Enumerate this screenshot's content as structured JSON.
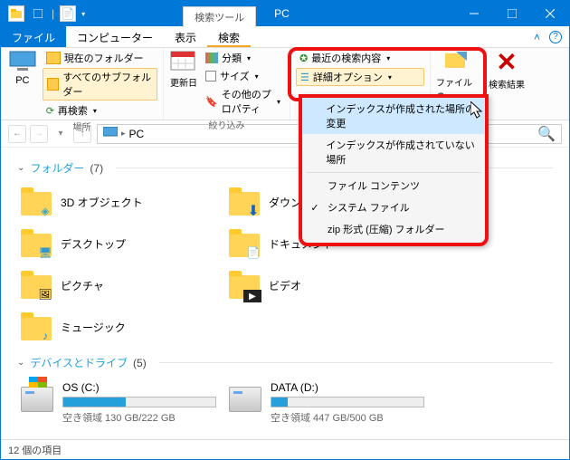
{
  "titlebar": {
    "contextual_tab": "検索ツール",
    "title": "PC"
  },
  "tabs": {
    "file": "ファイル",
    "computer": "コンピューター",
    "view": "表示",
    "search": "検索"
  },
  "ribbon": {
    "big_pc": "PC",
    "current_folder": "現在のフォルダー",
    "all_subfolders": "すべてのサブフォルダー",
    "resarch": "再検索",
    "group_location": "場所",
    "update_date": "更新日",
    "classify": "分類",
    "size": "サイズ",
    "other_props": "その他のプロパティ",
    "group_refine": "絞り込み",
    "recent_searches": "最近の検索内容",
    "advanced_options": "詳細オプション",
    "file_of": "ファイルの",
    "search_results": "検索結果"
  },
  "dropdown": {
    "change_indexed": "インデックスが作成された場所の変更",
    "not_indexed": "インデックスが作成されていない場所",
    "file_contents": "ファイル コンテンツ",
    "system_files": "システム ファイル",
    "zip_folders": "zip 形式 (圧縮) フォルダー"
  },
  "breadcrumb": {
    "pc": "PC"
  },
  "groups": {
    "folders_label": "フォルダー",
    "folders_count": "(7)",
    "drives_label": "デバイスとドライブ",
    "drives_count": "(5)"
  },
  "folders": {
    "obj3d": "3D オブジェクト",
    "desktop": "デスクトップ",
    "pictures": "ピクチャ",
    "music": "ミュージック",
    "downloads": "ダウンロード",
    "documents": "ドキュメント",
    "videos": "ビデオ"
  },
  "drives": {
    "c_label": "OS (C:)",
    "c_sub": "空き領域 130 GB/222 GB",
    "d_label": "DATA (D:)",
    "d_sub": "空き領域 447 GB/500 GB"
  },
  "status": {
    "items": "12 個の項目"
  }
}
